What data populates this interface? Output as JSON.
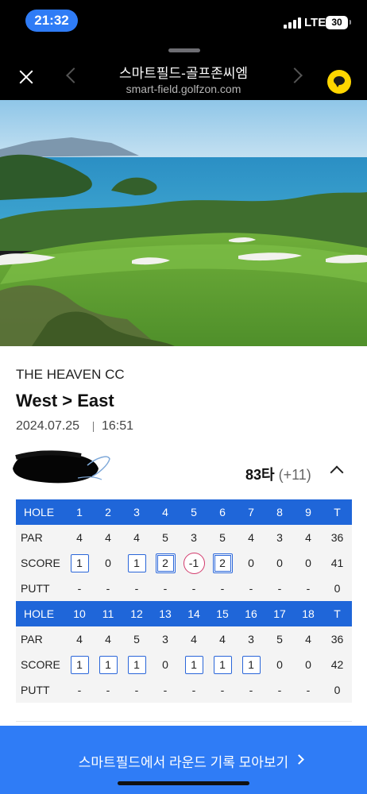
{
  "status_bar": {
    "time": "21:32",
    "network": "LTE",
    "battery": "30"
  },
  "header": {
    "title": "스마트필드-골프존씨엠",
    "url": "smart-field.golfzon.com"
  },
  "round": {
    "club": "THE HEAVEN CC",
    "course": "West > East",
    "date": "2024.07.25",
    "time": "16:51",
    "total": "83타",
    "over": "(+11)"
  },
  "scorecard": {
    "front": {
      "hole_label": "HOLE",
      "holes": [
        "1",
        "2",
        "3",
        "4",
        "5",
        "6",
        "7",
        "8",
        "9"
      ],
      "total_label": "T",
      "par_label": "PAR",
      "par": [
        "4",
        "4",
        "4",
        "5",
        "3",
        "5",
        "4",
        "3",
        "4"
      ],
      "par_total": "36",
      "score_label": "SCORE",
      "score": [
        "1",
        "0",
        "1",
        "2",
        "-1",
        "2",
        "0",
        "0",
        "0"
      ],
      "score_total": "41",
      "putt_label": "PUTT",
      "putt": [
        "-",
        "-",
        "-",
        "-",
        "-",
        "-",
        "-",
        "-",
        "-"
      ],
      "putt_total": "0"
    },
    "back": {
      "hole_label": "HOLE",
      "holes": [
        "10",
        "11",
        "12",
        "13",
        "14",
        "15",
        "16",
        "17",
        "18"
      ],
      "total_label": "T",
      "par_label": "PAR",
      "par": [
        "4",
        "4",
        "5",
        "3",
        "4",
        "4",
        "3",
        "5",
        "4"
      ],
      "par_total": "36",
      "score_label": "SCORE",
      "score": [
        "1",
        "1",
        "1",
        "0",
        "1",
        "1",
        "1",
        "0",
        "0"
      ],
      "score_total": "42",
      "putt_label": "PUTT",
      "putt": [
        "-",
        "-",
        "-",
        "-",
        "-",
        "-",
        "-",
        "-",
        "-"
      ],
      "putt_total": "0"
    }
  },
  "cta": {
    "label": "스마트필드에서 라운드 기록 모아보기"
  },
  "colors": {
    "accent": "#2f7cf6",
    "table_header": "#1f66d9",
    "birdie_circle": "#d23a6c"
  },
  "icons": {
    "close": "close-icon",
    "prev": "chevron-left-icon",
    "next": "chevron-right-icon",
    "chat": "kakaotalk-chat-icon",
    "collapse": "chevron-up-icon",
    "cta": "chevron-right-icon"
  }
}
